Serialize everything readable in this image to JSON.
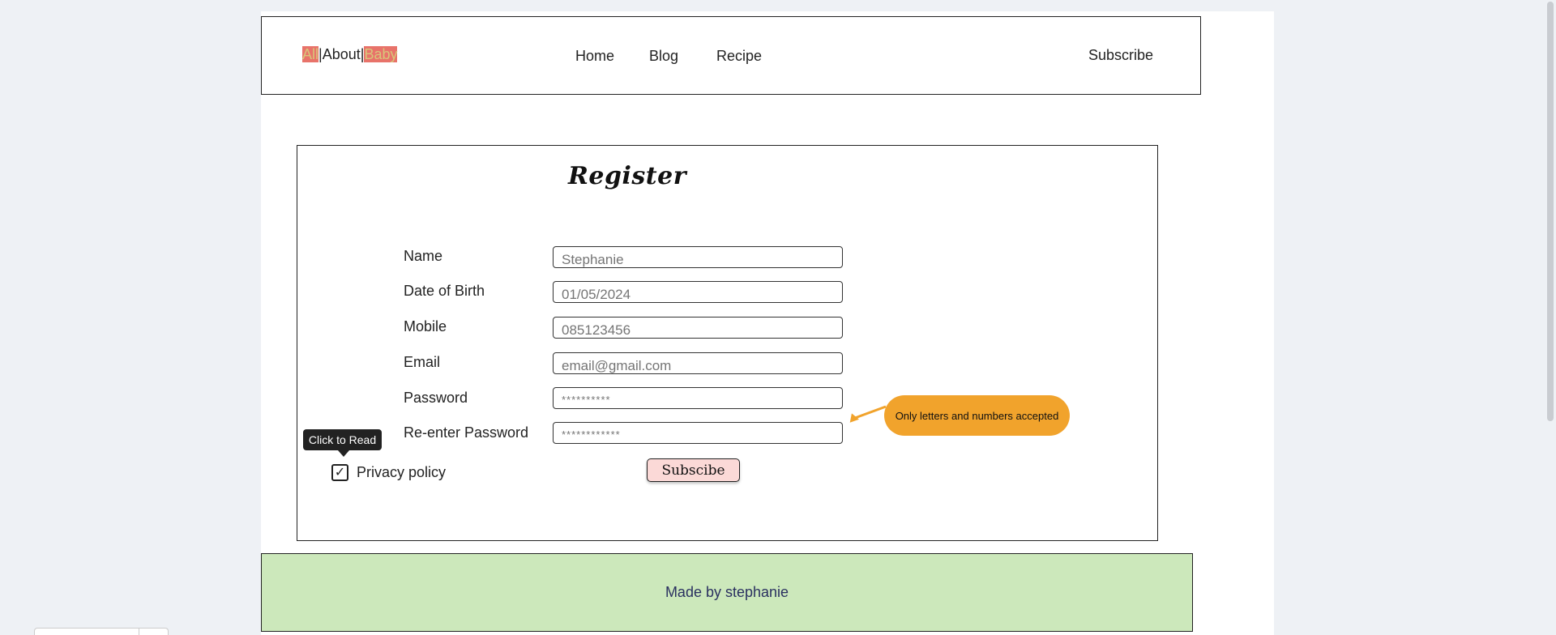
{
  "header": {
    "logo": {
      "part1": "All",
      "sep1": "|",
      "part2": "About",
      "sep2": "|",
      "part3": "Baby"
    },
    "nav": [
      {
        "label": "Home"
      },
      {
        "label": "Blog"
      },
      {
        "label": "Recipe"
      }
    ],
    "subscribe_label": "Subscribe"
  },
  "register": {
    "title": "Register",
    "fields": [
      {
        "label": "Name",
        "placeholder": "Stephanie"
      },
      {
        "label": "Date of Birth",
        "placeholder": "01/05/2024"
      },
      {
        "label": "Mobile",
        "placeholder": "085123456"
      },
      {
        "label": "Email",
        "placeholder": "email@gmail.com"
      },
      {
        "label": "Password",
        "placeholder": "**********"
      },
      {
        "label": "Re-enter Password",
        "placeholder": "************"
      }
    ],
    "tooltip": "Click to Read",
    "privacy_label": "Privacy policy",
    "privacy_checked": true,
    "checkbox_mark": "✓",
    "submit_label": "Subscibe",
    "callout_text": "Only letters and numbers accepted"
  },
  "footer": {
    "text": "Made by stephanie"
  },
  "colors": {
    "logo_highlight_bg": "#e8736a",
    "logo_highlight_fg": "#d8c67a",
    "footer_bg": "#cce8bb",
    "button_bg": "#fbd9d7",
    "callout_bg": "#f1a32c",
    "page_bg": "#eef1f5"
  },
  "icons": {
    "checkbox": "checkmark-icon",
    "callout_arrow": "arrow-icon"
  }
}
